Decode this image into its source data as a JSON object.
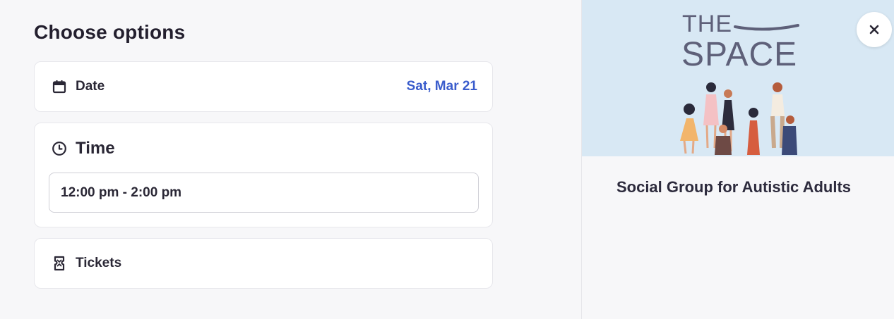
{
  "page": {
    "title": "Choose options"
  },
  "date": {
    "label": "Date",
    "value": "Sat, Mar 21",
    "icon": "calendar-icon"
  },
  "time": {
    "label": "Time",
    "selected": "12:00 pm - 2:00 pm",
    "icon": "clock-icon"
  },
  "tickets": {
    "label": "Tickets",
    "icon": "ticket-icon"
  },
  "event": {
    "logo_line1": "THE",
    "logo_line2": "SPACE",
    "title": "Social Group for Autistic Adults"
  },
  "colors": {
    "accent": "#3a5ccc",
    "text": "#231f2e",
    "hero_bg": "#d8e8f4",
    "logo": "#5e6079"
  },
  "close": {
    "icon": "close-icon"
  }
}
